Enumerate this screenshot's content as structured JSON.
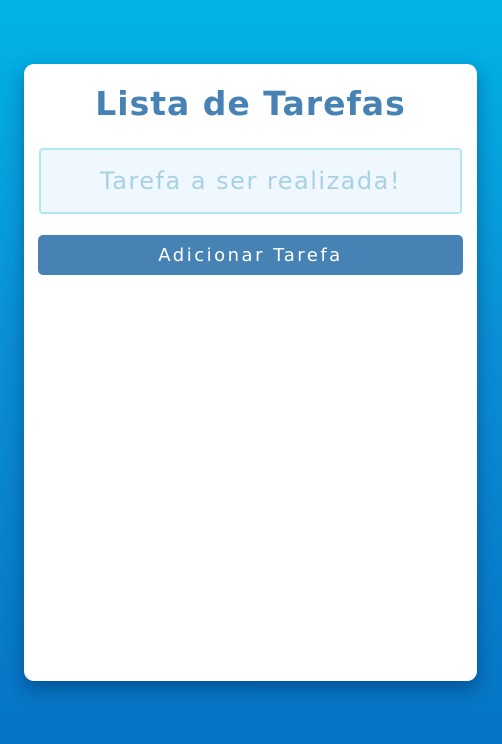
{
  "app": {
    "title": "Lista de Tarefas"
  },
  "form": {
    "input_value": "",
    "input_placeholder": "Tarefa a ser realizada!",
    "add_button_label": "Adicionar Tarefa"
  },
  "tasks": [],
  "colors": {
    "background_top": "#00b4e6",
    "background_bottom": "#0673c4",
    "card": "#ffffff",
    "accent": "#4682b4",
    "input_background": "#eef8fe",
    "input_border": "#aee8f0",
    "placeholder": "#a9d1e6"
  }
}
